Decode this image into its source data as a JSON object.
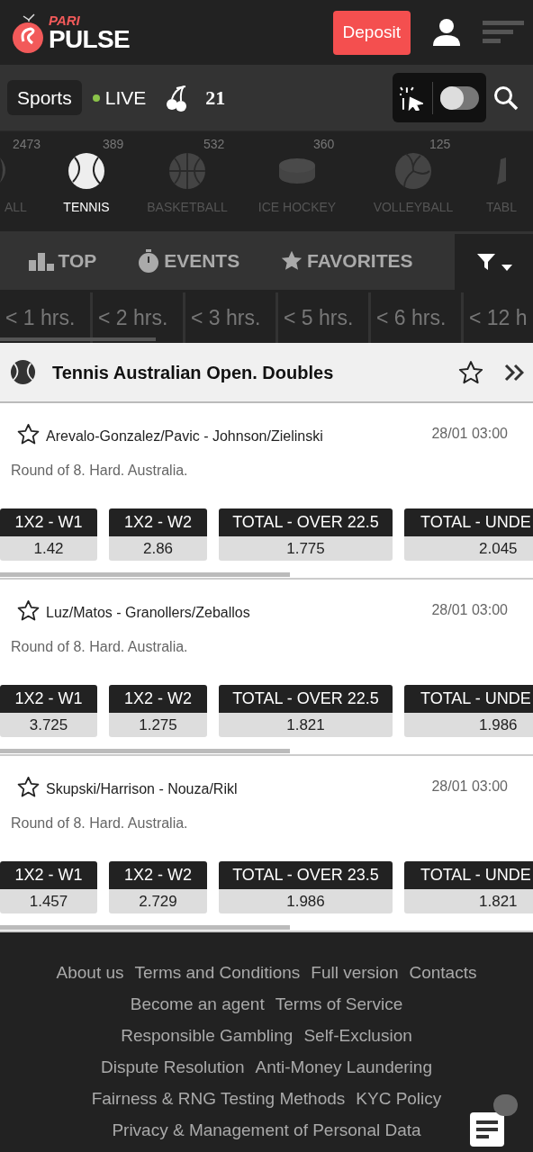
{
  "header": {
    "logo_top": "PARI",
    "logo_bottom": "PULSE",
    "deposit": "Deposit"
  },
  "nav": {
    "sports": {
      "label": "Sports",
      "selected": true
    },
    "live": "LIVE",
    "blackjack": "21",
    "toggle": {
      "on": false
    }
  },
  "sports": [
    {
      "label": "ALL",
      "count": "2473",
      "kind": "all",
      "selected": false
    },
    {
      "label": "TENNIS",
      "count": "389",
      "kind": "tennis",
      "selected": true
    },
    {
      "label": "BASKETBALL",
      "count": "532",
      "kind": "basketball",
      "selected": false
    },
    {
      "label": "ICE HOCKEY",
      "count": "360",
      "kind": "hockey",
      "selected": false
    },
    {
      "label": "VOLLEYBALL",
      "count": "125",
      "kind": "volleyball",
      "selected": false
    },
    {
      "label": "TABL",
      "kind": "table",
      "selected": false
    }
  ],
  "tabs": [
    {
      "label": "TOP",
      "kind": "top"
    },
    {
      "label": "EVENTS",
      "kind": "events"
    },
    {
      "label": "FAVORITES",
      "kind": "favorites"
    }
  ],
  "time_filters": [
    "< 1 hrs.",
    "< 2 hrs.",
    "< 3 hrs.",
    "< 5 hrs.",
    "< 6 hrs.",
    "< 12 h"
  ],
  "league": {
    "title": "Tennis Australian Open. Doubles",
    "favorite": false
  },
  "matches": [
    {
      "teams": "Arevalo-Gonzalez/Pavic - Johnson/Zielinski",
      "time": "28/01 03:00",
      "info": "Round of 8. Hard. Australia.",
      "favorite": false,
      "odds": [
        {
          "label": "1X2 - W1",
          "value": "1.42"
        },
        {
          "label": "1X2 - W2",
          "value": "2.86"
        },
        {
          "label": "TOTAL - OVER 22.5",
          "value": "1.775"
        },
        {
          "label": "TOTAL - UNDE",
          "value": "2.045"
        }
      ]
    },
    {
      "teams": "Luz/Matos - Granollers/Zeballos",
      "time": "28/01 03:00",
      "info": "Round of 8. Hard. Australia.",
      "favorite": false,
      "odds": [
        {
          "label": "1X2 - W1",
          "value": "3.725"
        },
        {
          "label": "1X2 - W2",
          "value": "1.275"
        },
        {
          "label": "TOTAL - OVER 22.5",
          "value": "1.821"
        },
        {
          "label": "TOTAL - UNDE",
          "value": "1.986"
        }
      ]
    },
    {
      "teams": "Skupski/Harrison - Nouza/Rikl",
      "time": "28/01 03:00",
      "info": "Round of 8. Hard. Australia.",
      "favorite": false,
      "odds": [
        {
          "label": "1X2 - W1",
          "value": "1.457"
        },
        {
          "label": "1X2 - W2",
          "value": "2.729"
        },
        {
          "label": "TOTAL - OVER 23.5",
          "value": "1.986"
        },
        {
          "label": "TOTAL - UNDE",
          "value": "1.821"
        }
      ]
    }
  ],
  "footer": {
    "rows": [
      [
        "About us",
        "Terms and Conditions",
        "Full version",
        "Contacts"
      ],
      [
        "Become an agent",
        "Terms of Service"
      ],
      [
        "Responsible Gambling",
        "Self-Exclusion"
      ],
      [
        "Dispute Resolution",
        "Anti-Money Laundering"
      ],
      [
        "Fairness & RNG Testing Methods",
        "KYC Policy"
      ],
      [
        "Privacy & Management of Personal Data"
      ]
    ]
  }
}
